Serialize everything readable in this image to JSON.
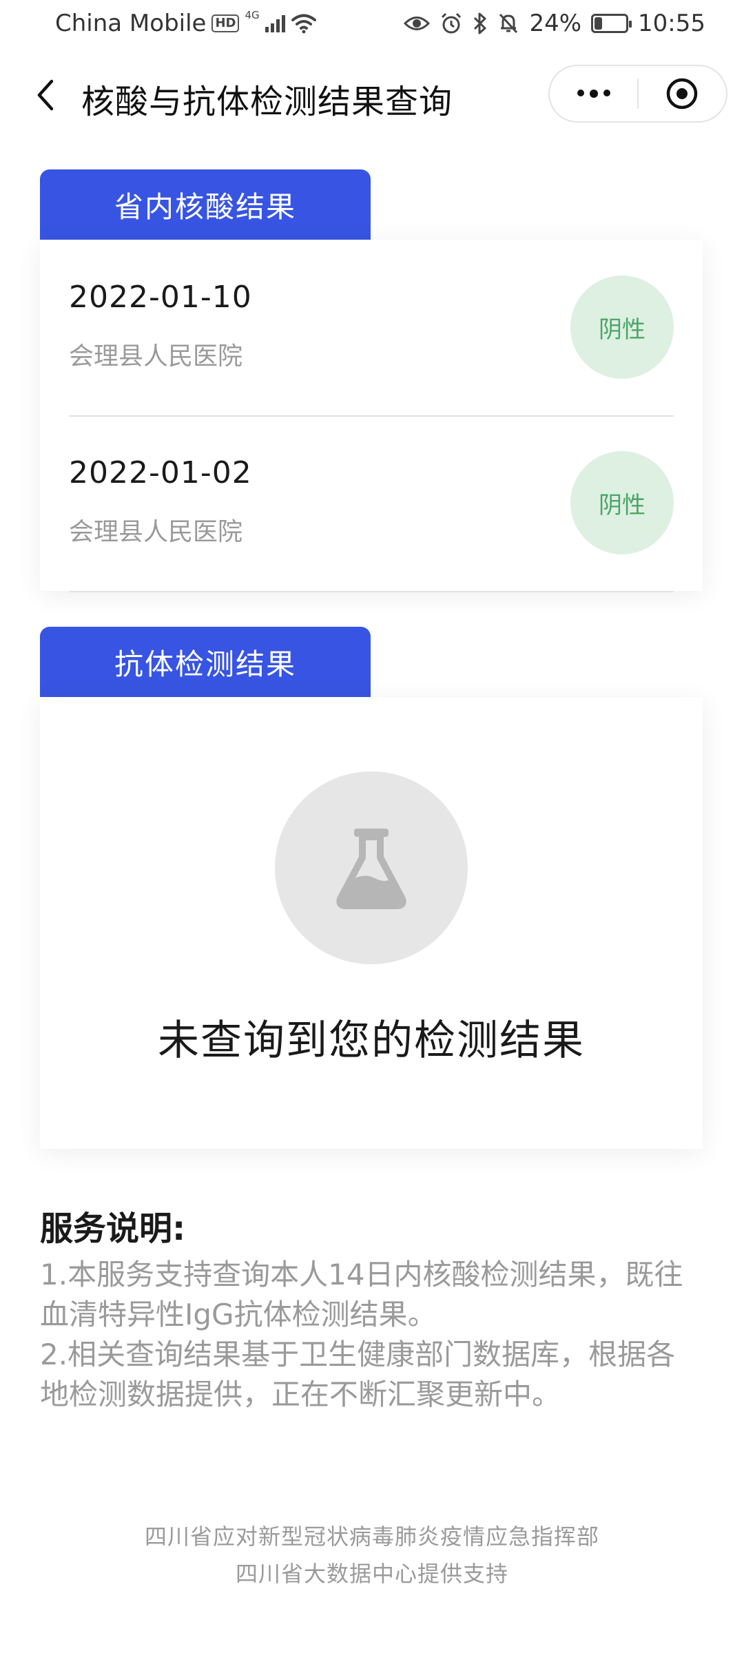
{
  "status_bar": {
    "carrier": "China Mobile",
    "hd": "HD",
    "network": "4G",
    "battery": "24%",
    "battery_level": 0.24,
    "time": "10:55"
  },
  "nav": {
    "title": "核酸与抗体检测结果查询"
  },
  "nucleic": {
    "tab_label": "省内核酸结果",
    "results": [
      {
        "date": "2022-01-10",
        "hospital": "会理县人民医院",
        "status": "阴性"
      },
      {
        "date": "2022-01-02",
        "hospital": "会理县人民医院",
        "status": "阴性"
      }
    ]
  },
  "antibody": {
    "tab_label": "抗体检测结果",
    "empty_icon": "flask-icon",
    "empty_text": "未查询到您的检测结果"
  },
  "service": {
    "title": "服务说明:",
    "item1": "1.本服务支持查询本人14日内核酸检测结果，既往血清特异性IgG抗体检测结果。",
    "item2": "2.相关查询结果基于卫生健康部门数据库，根据各地检测数据提供，正在不断汇聚更新中。"
  },
  "footer": {
    "line1": "四川省应对新型冠状病毒肺炎疫情应急指挥部",
    "line2": "四川省大数据中心提供支持"
  },
  "colors": {
    "accent": "#3755e2",
    "negative_badge_bg": "#ddf0e2",
    "negative_badge_text": "#4ca567"
  }
}
